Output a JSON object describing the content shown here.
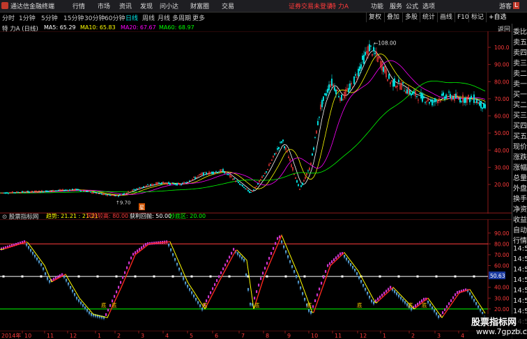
{
  "top_bar": {
    "app_title": "通达信金融终端",
    "menus": [
      "行情",
      "市场",
      "资讯",
      "发现",
      "问小达",
      "财富圈",
      "交易"
    ],
    "login_warning": "证券交易未登录",
    "stock_name": "特 力A",
    "right_items": [
      "功能",
      "服务",
      "公式",
      "选项",
      "游客"
    ]
  },
  "period_bar": {
    "periods": [
      "分时",
      "1分钟",
      "5分钟",
      "15分钟",
      "30分钟",
      "60分钟",
      "日线",
      "周线",
      "月线",
      "多周期",
      "更多"
    ],
    "active": "日线"
  },
  "tool_buttons": [
    "复权",
    "叠加",
    "多股",
    "统计",
    "画线",
    "F10",
    "标记"
  ],
  "main_chart": {
    "stock_label": "特 力A (日线)",
    "ma": [
      {
        "name": "MA5",
        "value": "65.29",
        "color": "#ffffff"
      },
      {
        "name": "MA10",
        "value": "65.83",
        "color": "#ffff00"
      },
      {
        "name": "MA20",
        "value": "67.67",
        "color": "#ff00ff"
      },
      {
        "name": "MA60",
        "value": "68.97",
        "color": "#00ff00"
      }
    ],
    "back_label": "返回",
    "high_label": "108.00",
    "low_label": "9.70",
    "event_marker": "星",
    "y_ticks": [
      "100.0",
      "90.00",
      "80.00",
      "70.00",
      "60.00",
      "50.00",
      "40.00",
      "30.00",
      "20.00"
    ]
  },
  "indicator": {
    "name": "股票指标网",
    "trend_label": "趋势: 21.21  : 21.21",
    "risk_label": "风险较高: 80.00",
    "profit_label": "获利回抛: 50.00",
    "bottom_label": "抄底区: 20.00",
    "current_value": "50.63",
    "bottom_markers": [
      "底",
      "底",
      "底",
      "底",
      "底",
      "底",
      "底",
      "底"
    ],
    "y_ticks": [
      "90.00",
      "80.00",
      "70.00",
      "60.00",
      "40.00",
      "30.00",
      "20.00"
    ]
  },
  "x_axis": {
    "year": "2014年",
    "labels": [
      "10",
      "11",
      "12",
      "1",
      "2",
      "3",
      "4",
      "5",
      "6",
      "7",
      "8",
      "9",
      "10",
      "11",
      "12",
      "1",
      "2",
      "3",
      "4"
    ]
  },
  "right_panel": {
    "badge": "L",
    "items": [
      "委比",
      "卖五",
      "卖四",
      "卖三",
      "卖二",
      "卖一",
      "买一",
      "买二",
      "买三",
      "买四",
      "买五",
      "现价",
      "涨跌",
      "涨幅",
      "总量",
      "外盘",
      "换手",
      "净资",
      "收益",
      "自动",
      "行情",
      "14:5",
      "14:5",
      "14:5",
      "14:5",
      "14:5",
      "14:5",
      "14:5",
      "14:5",
      "14:5"
    ]
  },
  "watermark": {
    "line1": "股票指标网",
    "line2": "www.7gpzb.com"
  },
  "colors": {
    "up": "#ff3b3b",
    "down": "#00e5e5",
    "ma5": "#ffffff",
    "ma10": "#ffff00",
    "ma20": "#ff00ff",
    "ma60": "#00ff00"
  }
}
